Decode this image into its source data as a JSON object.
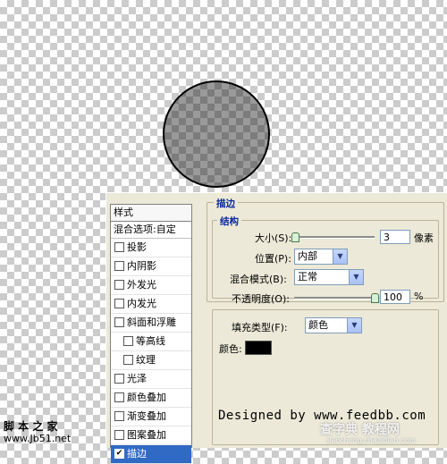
{
  "styles_panel": {
    "header": "样式",
    "blend_options": "混合选项:自定",
    "items": [
      {
        "label": "投影",
        "checked": false,
        "sub": false,
        "selected": false
      },
      {
        "label": "内阴影",
        "checked": false,
        "sub": false,
        "selected": false
      },
      {
        "label": "外发光",
        "checked": false,
        "sub": false,
        "selected": false
      },
      {
        "label": "内发光",
        "checked": false,
        "sub": false,
        "selected": false
      },
      {
        "label": "斜面和浮雕",
        "checked": false,
        "sub": false,
        "selected": false
      },
      {
        "label": "等高线",
        "checked": false,
        "sub": true,
        "selected": false
      },
      {
        "label": "纹理",
        "checked": false,
        "sub": true,
        "selected": false
      },
      {
        "label": "光泽",
        "checked": false,
        "sub": false,
        "selected": false
      },
      {
        "label": "颜色叠加",
        "checked": false,
        "sub": false,
        "selected": false
      },
      {
        "label": "渐变叠加",
        "checked": false,
        "sub": false,
        "selected": false
      },
      {
        "label": "图案叠加",
        "checked": false,
        "sub": false,
        "selected": false
      },
      {
        "label": "描边",
        "checked": true,
        "sub": false,
        "selected": true
      }
    ]
  },
  "stroke": {
    "title": "描边",
    "structure_title": "结构",
    "size_label": "大小(S):",
    "size_value": "3",
    "size_unit": "像素",
    "size_fraction": 0.01,
    "position_label": "位置(P):",
    "position_value": "内部",
    "blend_label": "混合模式(B):",
    "blend_value": "正常",
    "opacity_label": "不透明度(O):",
    "opacity_value": "100",
    "opacity_unit": "%",
    "opacity_fraction": 1.0,
    "fill_type_label": "填充类型(F):",
    "fill_type_value": "颜色",
    "color_label": "颜色:",
    "color_hex": "#000000"
  },
  "watermarks": {
    "designed_by": "Designed by www.feedbb.com",
    "site_cn": "脚 本 之 家",
    "site_url": "www.Jb51.net",
    "right_site_cn": "查字典 教程网",
    "right_site_url": "jiaocheng.chazidian.com"
  },
  "icons": {
    "checkmark": "✔",
    "dropdown": "▼"
  }
}
